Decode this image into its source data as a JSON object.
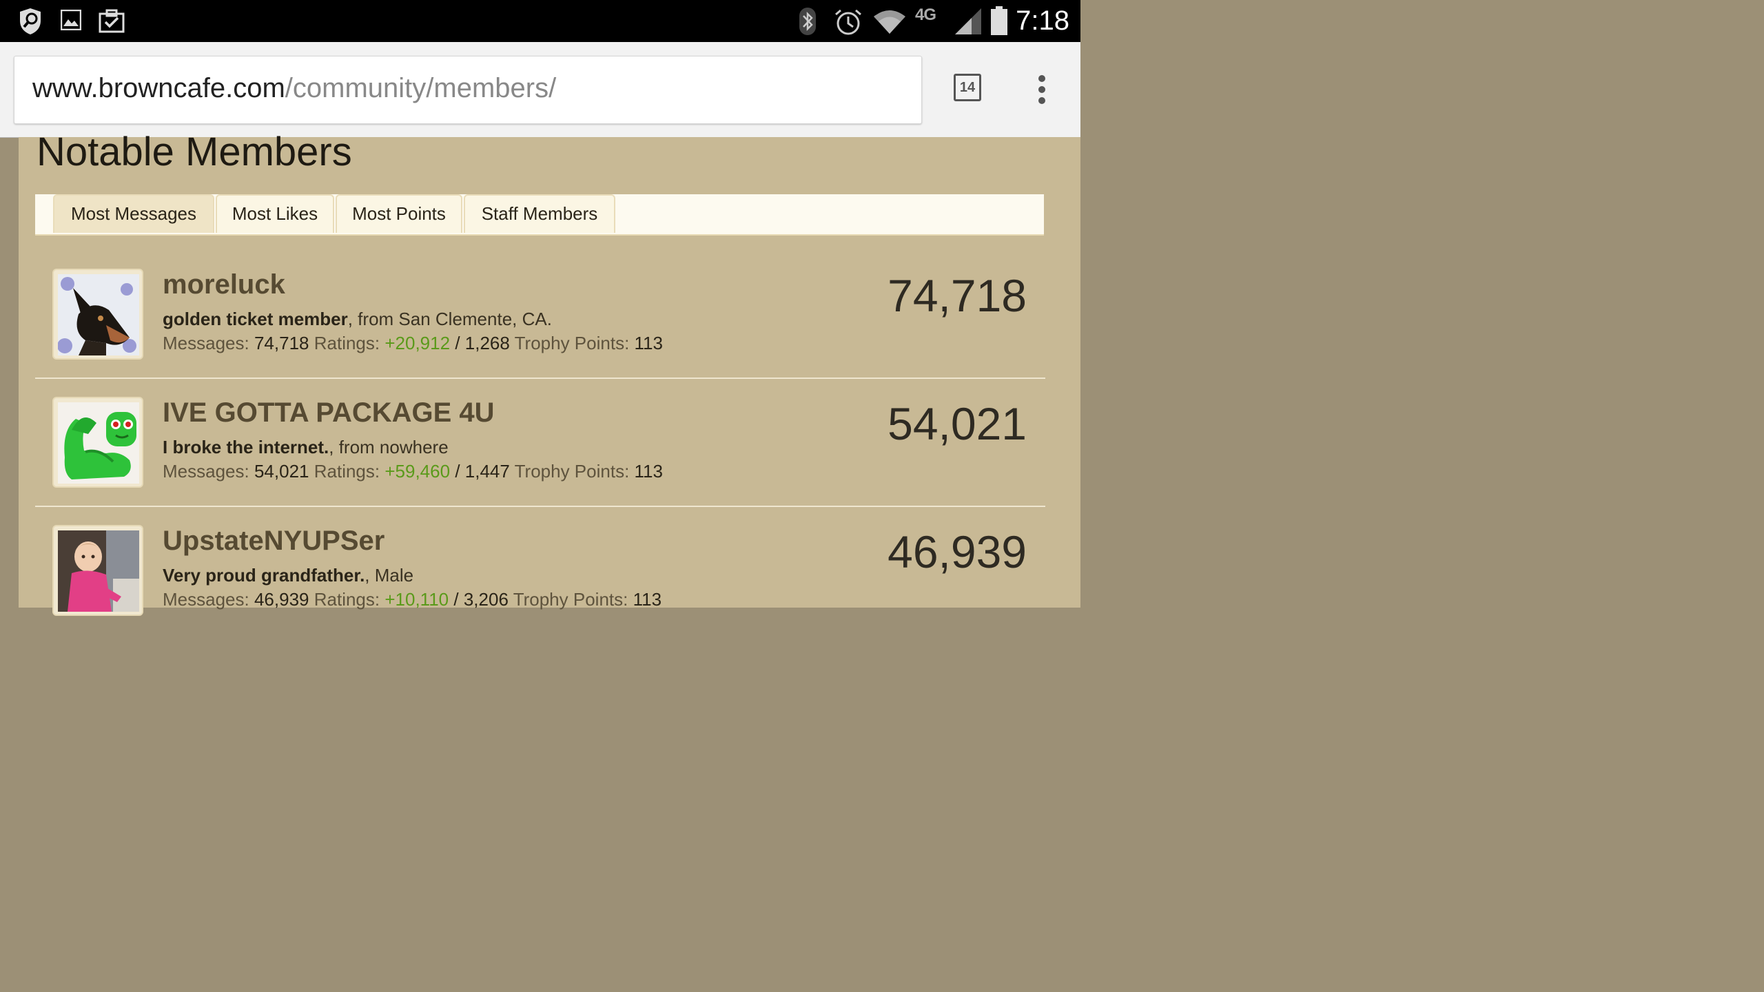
{
  "status_bar": {
    "time": "7:18",
    "network": "4G"
  },
  "browser": {
    "url_domain": "www.browncafe.com",
    "url_path": "/community/members/",
    "tab_count": "14"
  },
  "page": {
    "heading": "Notable Members",
    "tabs": [
      {
        "label": "Most Messages",
        "active": true
      },
      {
        "label": "Most Likes"
      },
      {
        "label": "Most Points"
      },
      {
        "label": "Staff Members"
      }
    ],
    "members": [
      {
        "name": "moreluck",
        "title": "golden ticket member",
        "suffix": ", from San Clemente, CA.",
        "messages_label": "Messages:",
        "messages": "74,718",
        "ratings_label": "Ratings:",
        "ratings_pos": "+20,912",
        "sep": "/",
        "ratings_other": "1,268",
        "trophy_label": "Trophy Points:",
        "trophy": "113",
        "count": "74,718"
      },
      {
        "name": "IVE GOTTA PACKAGE 4U",
        "title": "I broke the internet.",
        "suffix": ", from nowhere",
        "messages_label": "Messages:",
        "messages": "54,021",
        "ratings_label": "Ratings:",
        "ratings_pos": "+59,460",
        "sep": "/",
        "ratings_other": "1,447",
        "trophy_label": "Trophy Points:",
        "trophy": "113",
        "count": "54,021"
      },
      {
        "name": "UpstateNYUPSer",
        "title": "Very proud grandfather.",
        "suffix": ", Male",
        "messages_label": "Messages:",
        "messages": "46,939",
        "ratings_label": "Ratings:",
        "ratings_pos": "+10,110",
        "sep": "/",
        "ratings_other": "3,206",
        "trophy_label": "Trophy Points:",
        "trophy": "113",
        "count": "46,939"
      }
    ]
  },
  "icons": {
    "status_left": [
      "shield-search-icon",
      "image-icon",
      "clipboard-check-icon"
    ],
    "status_right": [
      "bluetooth-icon",
      "alarm-icon",
      "wifi-icon",
      "signal-icon",
      "battery-icon"
    ],
    "browser": [
      "tabs-icon",
      "overflow-menu-icon"
    ]
  },
  "colors": {
    "page_bg": "#c8b995",
    "ratings_positive": "#5a9a1a",
    "username": "#564a32"
  }
}
